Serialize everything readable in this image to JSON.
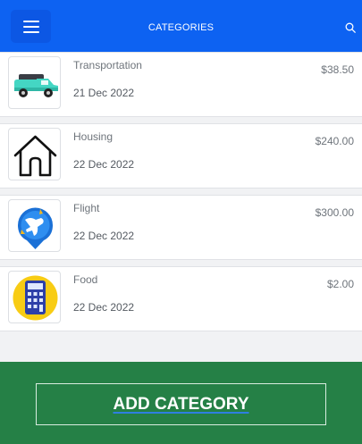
{
  "header": {
    "title": "CATEGORIES",
    "menu_icon": "hamburger-menu-icon",
    "search_icon": "search-icon",
    "color": "#0d62f2"
  },
  "categories": [
    {
      "name": "Transportation",
      "date": "21 Dec 2022",
      "amount": "$38.50",
      "icon": "truck-icon"
    },
    {
      "name": "Housing",
      "date": "22 Dec 2022",
      "amount": "$240.00",
      "icon": "house-icon"
    },
    {
      "name": "Flight",
      "date": "22 Dec 2022",
      "amount": "$300.00",
      "icon": "airplane-icon"
    },
    {
      "name": "Food",
      "date": "22 Dec 2022",
      "amount": "$2.00",
      "icon": "calculator-icon"
    }
  ],
  "footer": {
    "add_label": "ADD CATEGORY",
    "color": "#258046"
  }
}
